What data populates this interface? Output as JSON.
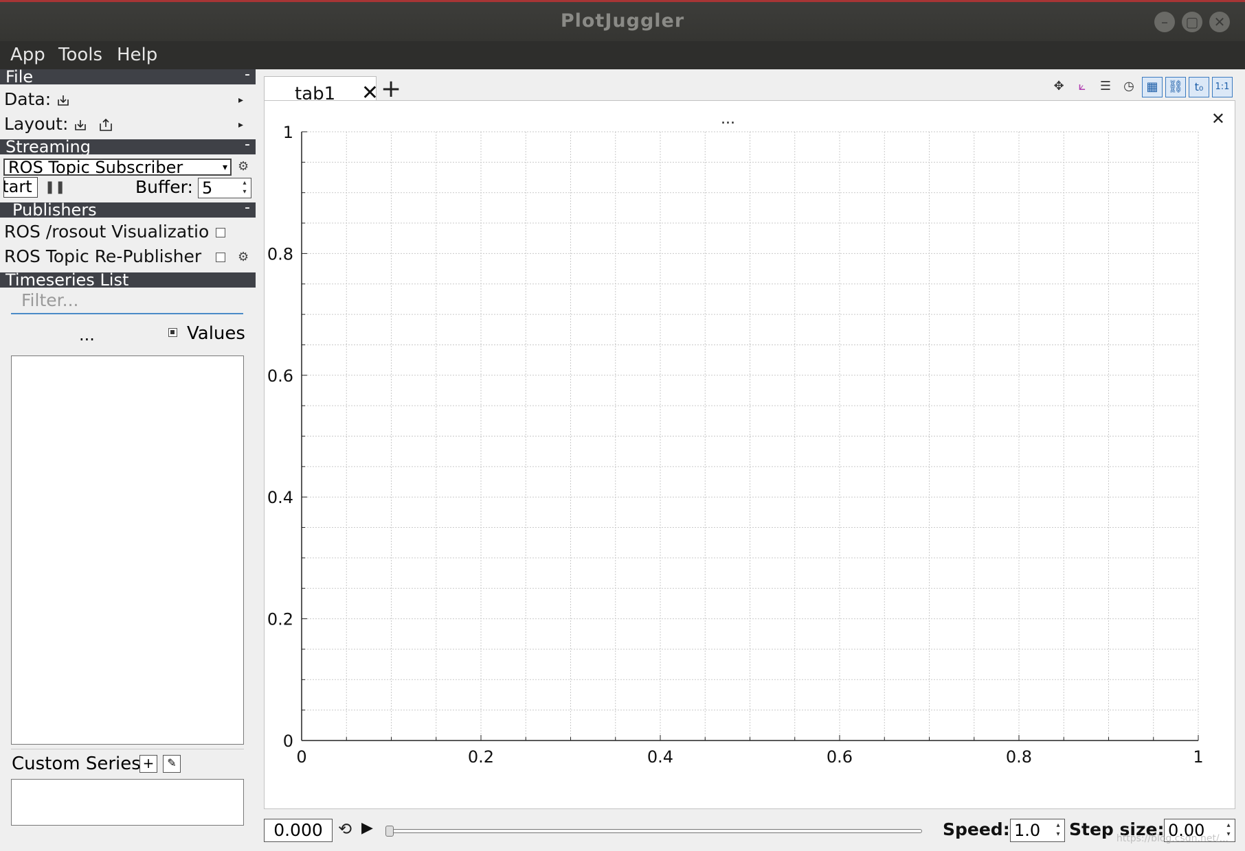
{
  "window": {
    "title": "PlotJuggler"
  },
  "menu": {
    "items": [
      "App",
      "Tools",
      "Help"
    ]
  },
  "sidebar": {
    "file": {
      "header": "File",
      "minimize": "-",
      "data_label": "Data:",
      "layout_label": "Layout:"
    },
    "streaming": {
      "header": "Streaming",
      "minimize": "-",
      "source": "ROS Topic Subscriber",
      "start_label": "Start",
      "buffer_label": "Buffer:",
      "buffer_value": "5"
    },
    "publishers": {
      "header": "Publishers",
      "minimize": "-",
      "items": [
        "ROS /rosout Visualization",
        "ROS Topic Re-Publisher"
      ]
    },
    "timeseries": {
      "header": "Timeseries List",
      "filter_placeholder": "Filter...",
      "dots": "...",
      "values_label": "Values",
      "custom_series_label": "Custom Series:"
    }
  },
  "main": {
    "tabs": [
      {
        "label": "tab1"
      }
    ],
    "plot_title": "...",
    "bottom": {
      "time": "0.000",
      "speed_label": "Speed:",
      "speed_value": "1.0",
      "step_label": "Step size:",
      "step_value": "0.00"
    }
  },
  "chart_data": {
    "type": "line",
    "series": [],
    "xlim": [
      0,
      1
    ],
    "ylim": [
      0,
      1
    ],
    "x_ticks": [
      "0",
      "0.2",
      "0.4",
      "0.6",
      "0.8",
      "1"
    ],
    "y_ticks": [
      "0",
      "0.2",
      "0.4",
      "0.6",
      "0.8",
      "1"
    ],
    "grid": true
  },
  "watermark": "https://blog.csdn.net/..."
}
